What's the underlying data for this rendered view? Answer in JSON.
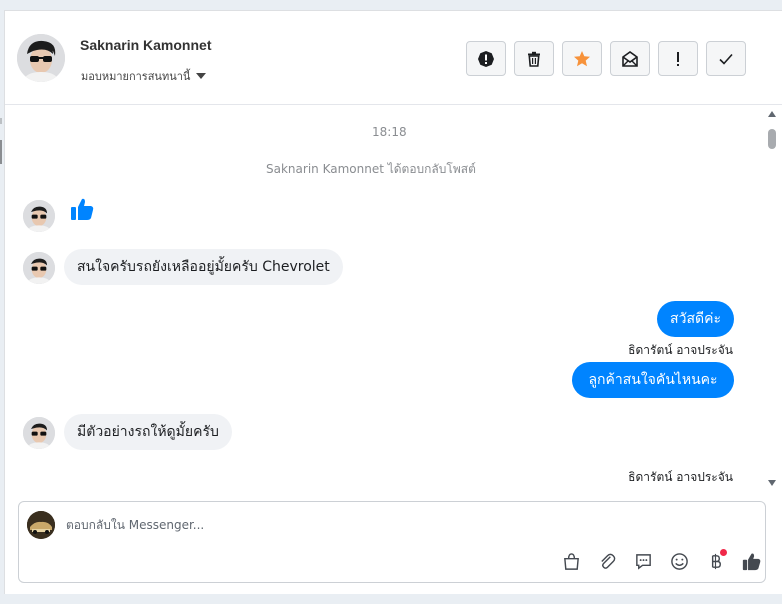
{
  "header": {
    "contact_name": "Saknarin Kamonnet",
    "assign_label": "มอบหมายการสนทนานี้"
  },
  "actions": [
    {
      "icon": "alert-circle-icon",
      "label": "spam"
    },
    {
      "icon": "trash-icon",
      "label": "delete"
    },
    {
      "icon": "star-icon",
      "label": "star"
    },
    {
      "icon": "mark-unread-icon",
      "label": "mark unread"
    },
    {
      "icon": "exclamation-icon",
      "label": "follow up"
    },
    {
      "icon": "check-icon",
      "label": "done"
    }
  ],
  "thread": {
    "time": "18:18",
    "system_text": "Saknarin Kamonnet ได้ตอบกลับโพสต์",
    "incoming_1": "สนใจครับรถยังเหลืออยู่มั้ยครับ Chevrolet",
    "outgoing_1": "สวัสดีค่ะ",
    "sender_1": "ธิดารัตน์ อาจประจัน",
    "outgoing_2": "ลูกค้าสนใจคันไหนคะ",
    "incoming_2": "มีตัวอย่างรถให้ดูมั้ยครับ",
    "sender_2": "ธิดารัตน์ อาจประจัน"
  },
  "composer": {
    "placeholder": "ตอบกลับใน Messenger...",
    "value": ""
  },
  "colors": {
    "accent": "#0084ff",
    "star": "#f7923a",
    "notification_dot": "#f02849"
  }
}
